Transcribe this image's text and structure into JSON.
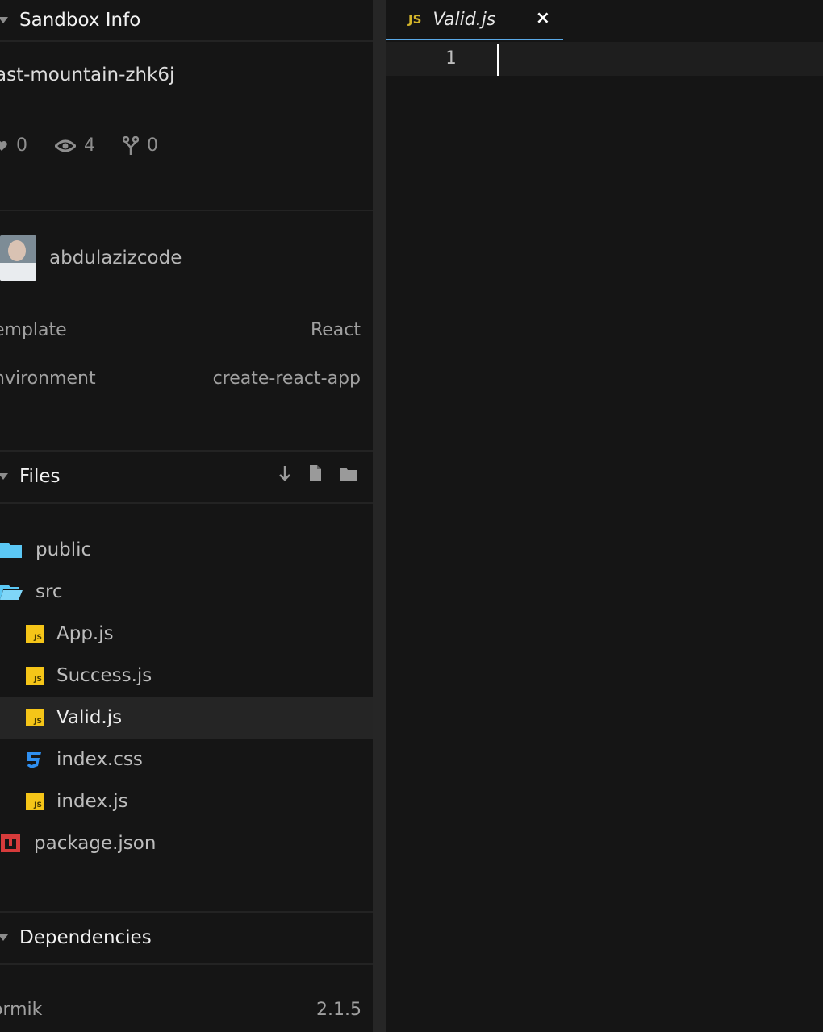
{
  "sandbox_info": {
    "header": "Sandbox Info",
    "name": "ast-mountain-zhk6j",
    "stats": {
      "likes": "0",
      "views": "4",
      "forks": "0"
    },
    "author": "abdulazizcode",
    "template_label": "emplate",
    "template_value": "React",
    "environment_label": "nvironment",
    "environment_value": "create-react-app"
  },
  "files": {
    "header": "Files",
    "items": [
      {
        "name": "public",
        "type": "folder"
      },
      {
        "name": "src",
        "type": "folder-open"
      },
      {
        "name": "App.js",
        "type": "js"
      },
      {
        "name": "Success.js",
        "type": "js"
      },
      {
        "name": "Valid.js",
        "type": "js",
        "active": true
      },
      {
        "name": "index.css",
        "type": "css"
      },
      {
        "name": "index.js",
        "type": "js"
      },
      {
        "name": "package.json",
        "type": "npm"
      }
    ]
  },
  "dependencies": {
    "header": "Dependencies",
    "items": [
      {
        "name": "ormik",
        "version": "2.1.5"
      }
    ]
  },
  "editor": {
    "tab": {
      "badge": "JS",
      "title": "Valid.js",
      "close": "×"
    },
    "line_number": "1"
  },
  "icons": {
    "js_badge": "JS",
    "folder_color": "#5bc8f5",
    "css_color": "#2f8ff0",
    "npm_color": "#d63b3b",
    "accent": "#5aa9e6"
  }
}
